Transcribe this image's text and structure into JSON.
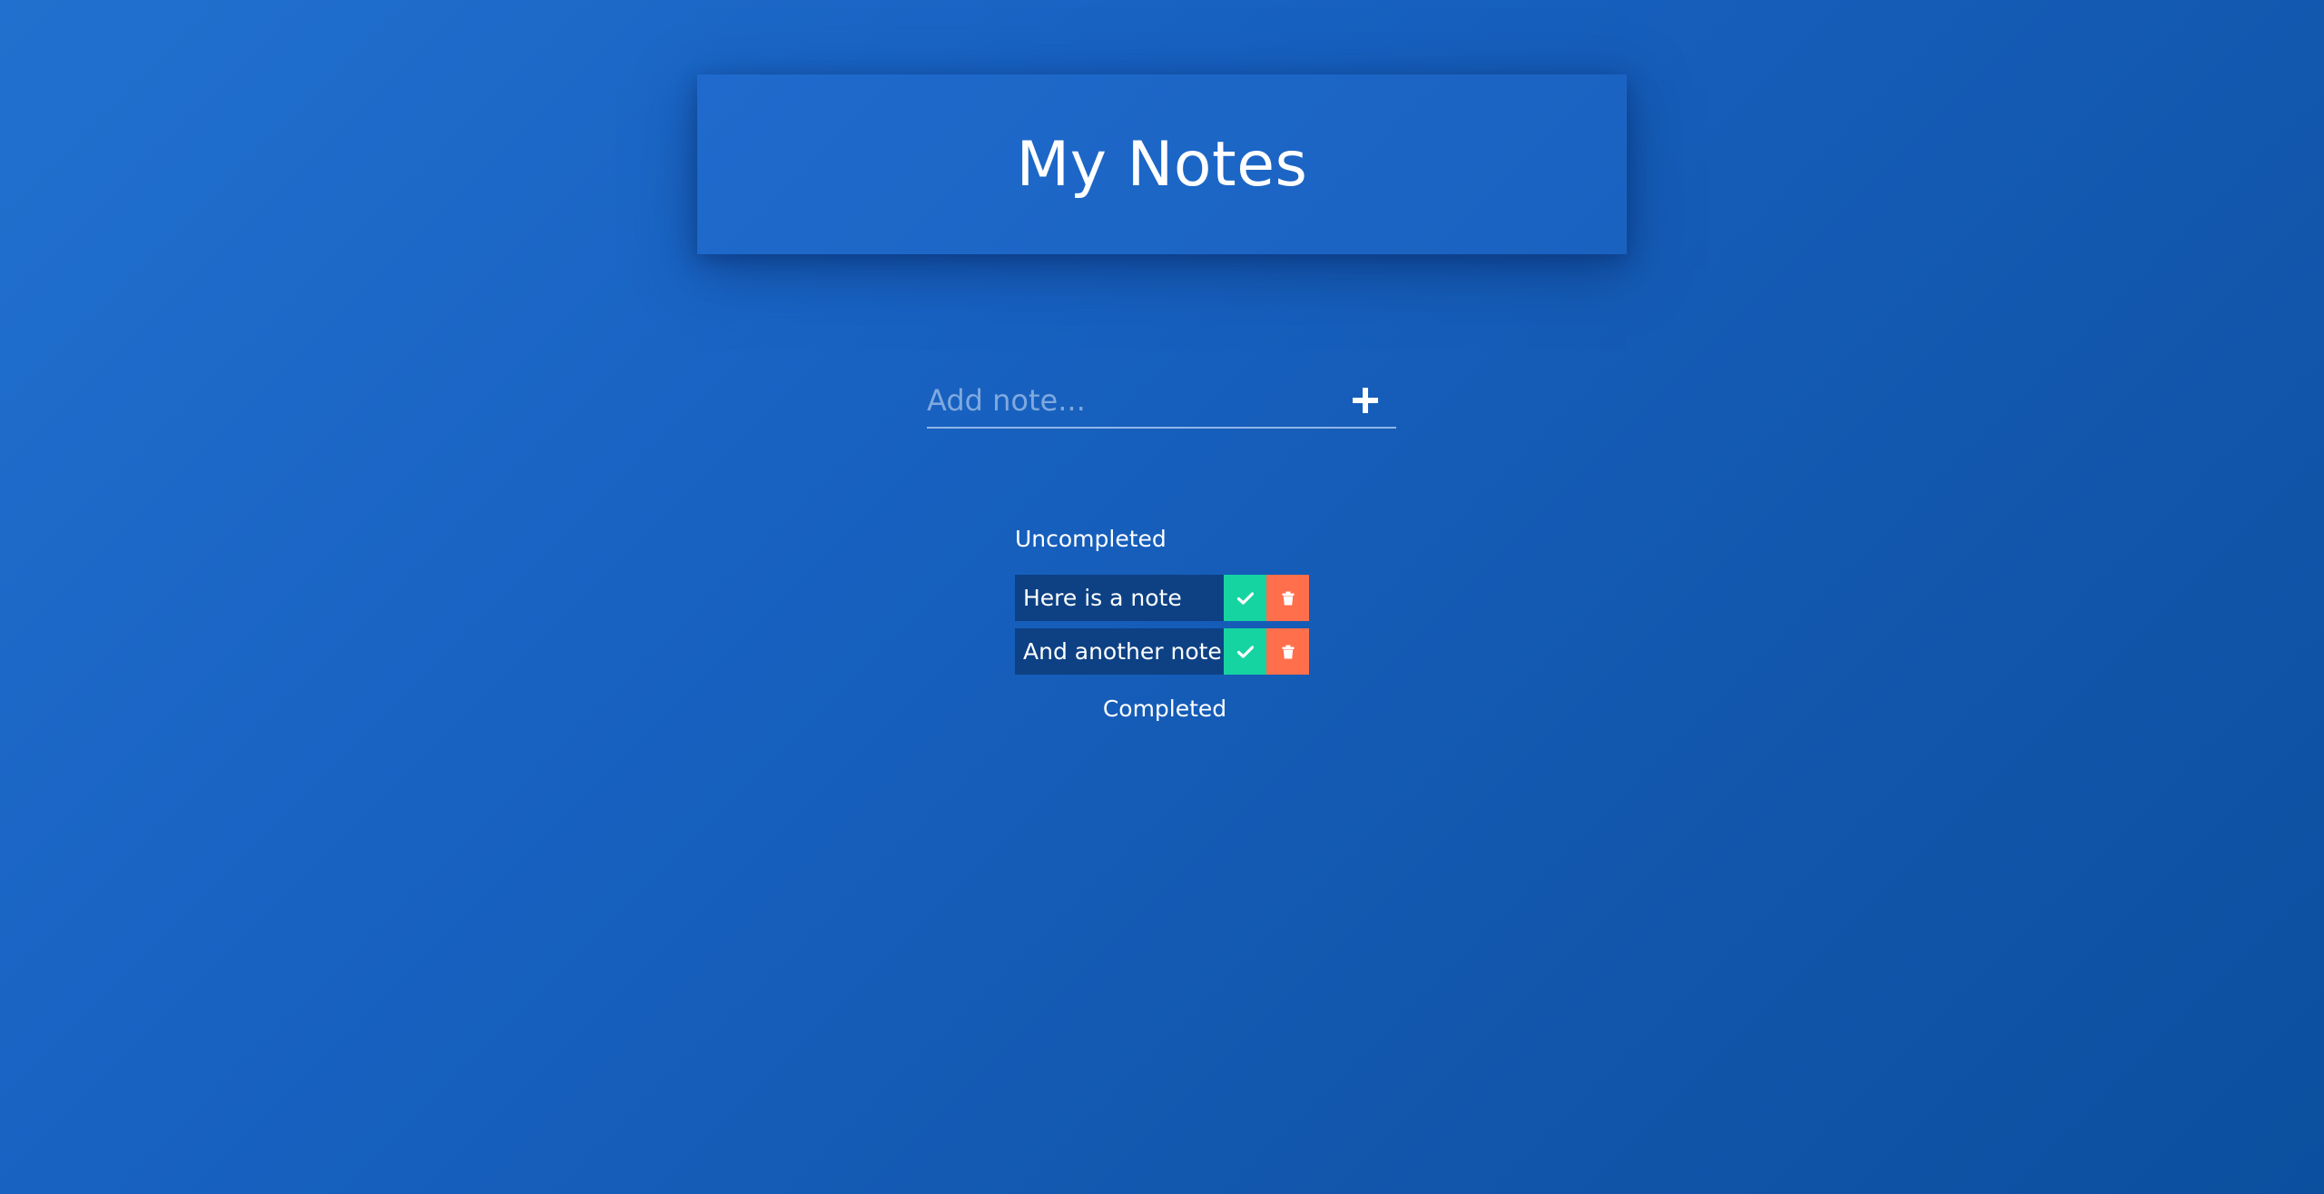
{
  "header": {
    "title": "My Notes"
  },
  "add_form": {
    "placeholder": "Add note...",
    "value": "",
    "add_icon": "plus-icon"
  },
  "sections": {
    "uncompleted_label": "Uncompleted",
    "completed_label": "Completed"
  },
  "notes": {
    "uncompleted": [
      {
        "text": "Here is a note",
        "complete_icon": "check-icon",
        "delete_icon": "trash-icon"
      },
      {
        "text": "And another note",
        "complete_icon": "check-icon",
        "delete_icon": "trash-icon"
      }
    ],
    "completed": []
  },
  "colors": {
    "background": "#1862c2",
    "header_card": "#1f6acc",
    "note_bg": "#0d4184",
    "complete_green": "#16d4a1",
    "delete_orange": "#ff6f4b",
    "placeholder": "#7fa9df"
  }
}
